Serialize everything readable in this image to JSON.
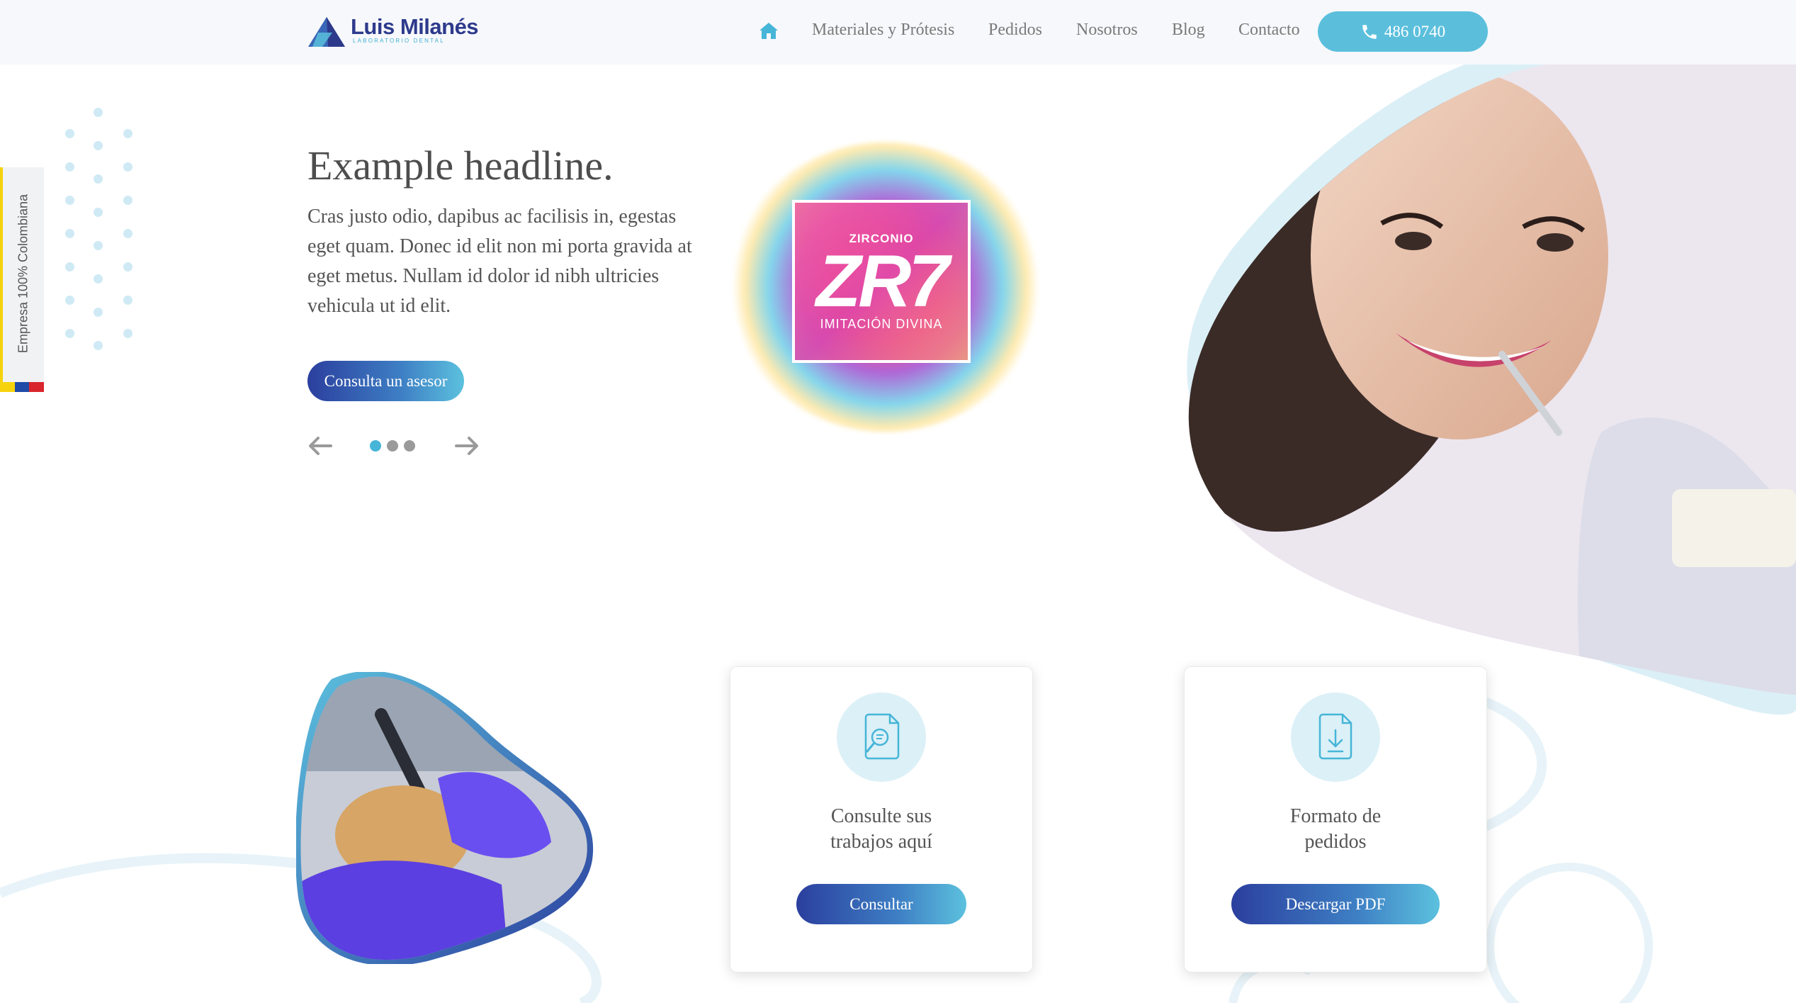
{
  "header": {
    "logo": {
      "name": "Luis Milanés",
      "subtitle": "LABORATORIO DENTAL"
    },
    "nav": [
      "Materiales y Prótesis",
      "Pedidos",
      "Nosotros",
      "Blog",
      "Contacto"
    ],
    "phone": "486 0740"
  },
  "side_badge": {
    "text": "Empresa 100% Colombiana",
    "flag_colors": [
      "#f5d20c",
      "#1f4aa8",
      "#d8262c"
    ]
  },
  "hero": {
    "title": "Example headline.",
    "text": "Cras justo odio, dapibus ac facilisis in, egestas eget quam. Donec id elit non mi porta gravida at eget metus. Nullam id dolor id nibh ultricies vehicula ut id elit.",
    "button": "Consulta un asesor",
    "carousel": {
      "slides": 3,
      "active": 1
    }
  },
  "promo": {
    "top": "ZIRCONIO",
    "main": "ZR7",
    "sub": "IMITACIÓN DIVINA"
  },
  "cards": [
    {
      "title": "Consulte sus trabajos aquí",
      "button": "Consultar",
      "icon": "document-search-icon"
    },
    {
      "title": "Formato de pedidos",
      "button": "Descargar PDF",
      "icon": "document-download-icon"
    }
  ],
  "colors": {
    "accent": "#5bbfdc",
    "brand": "#2d3a8c",
    "button_start": "#2b3f9e",
    "button_end": "#5cc1de"
  }
}
